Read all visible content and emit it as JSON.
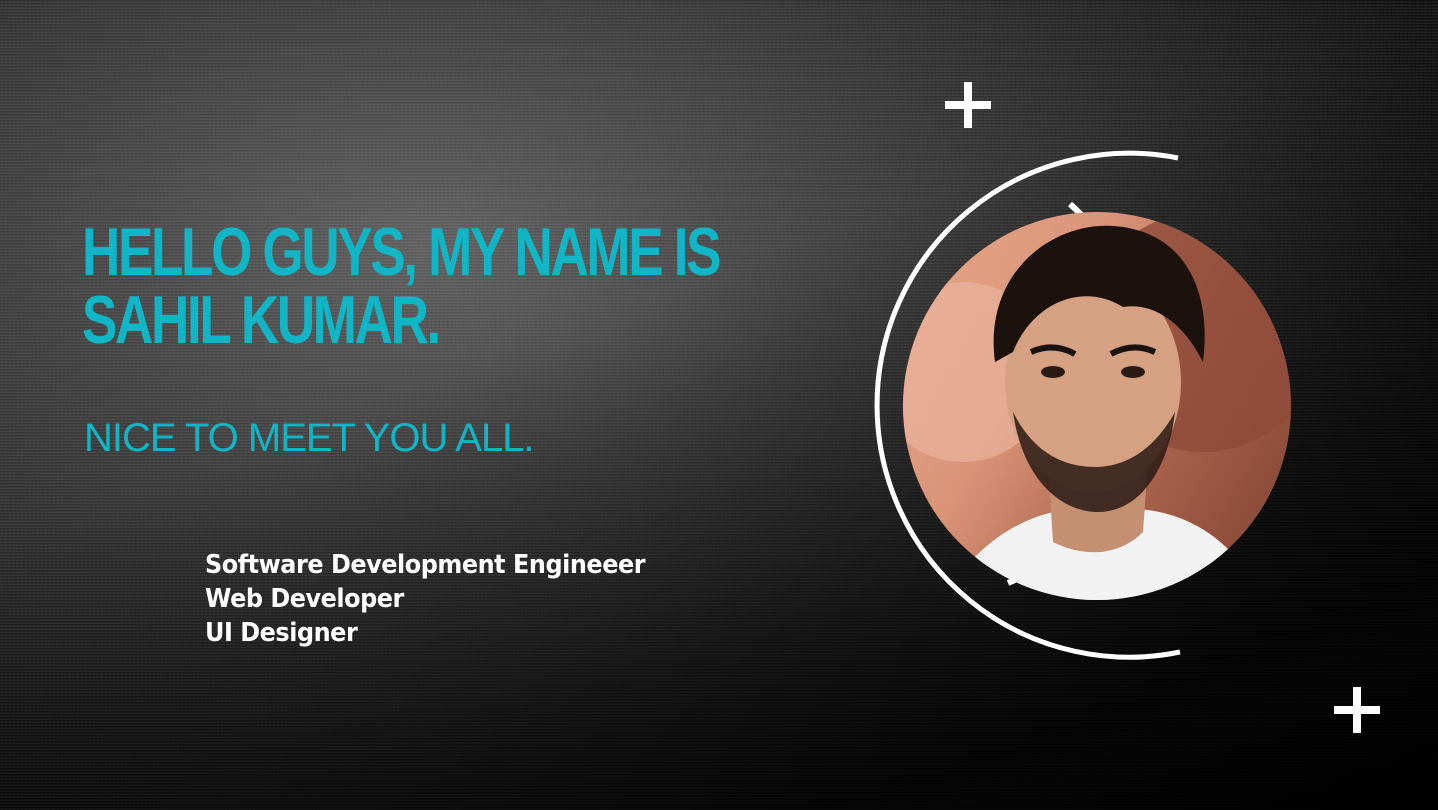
{
  "hero": {
    "headline_line1": "HELLO GUYS, MY NAME IS",
    "headline_line2": "SAHIL KUMAR.",
    "subheading": "NICE TO MEET YOU ALL.",
    "roles": [
      "Software Development Engineeer",
      "Web Developer",
      "UI Designer"
    ]
  },
  "profile": {
    "photo_alt": "Sahil Kumar"
  },
  "colors": {
    "accent": "#10b6c6",
    "text": "#ffffff",
    "background": "#000000"
  },
  "icons": [
    "plus-icon",
    "plus-icon"
  ]
}
